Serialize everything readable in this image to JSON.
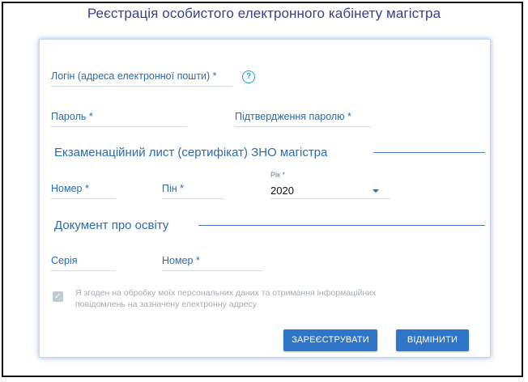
{
  "page": {
    "title": "Реєстрація особистого електронного кабінету магістра"
  },
  "form": {
    "login": {
      "label": "Логін (адреса електронної пошти) *",
      "help_icon": "?"
    },
    "password": {
      "label": "Пароль *"
    },
    "password_confirm": {
      "label": "Підтвердження паролю *"
    },
    "zno_section": {
      "title": "Екзаменаційний лист (сертифікат) ЗНО магістра",
      "number": {
        "label": "Номер *"
      },
      "pin": {
        "label": "Пін *"
      },
      "year": {
        "label": "Рік *",
        "value": "2020"
      }
    },
    "education_section": {
      "title": "Документ про освіту",
      "series": {
        "label": "Серія"
      },
      "number": {
        "label": "Номер *"
      }
    },
    "consent": {
      "checked": true,
      "text_line1": "Я згоден на обробку моїх персональних даних та отримання інформаційних",
      "text_line2": "повідомлень на зазначену електронну адресу"
    },
    "buttons": {
      "register": "ЗАРЕЄСТРУВАТИ",
      "cancel": "ВІДМІНИТИ"
    }
  },
  "colors": {
    "title": "#3a3f87",
    "label": "#2b6cb0",
    "help_icon": "#1fa3c9",
    "button": "#2f76c8",
    "card_glow": "#4678c8"
  },
  "icons": {
    "help": "question-circle-icon",
    "checkbox": "check-icon",
    "caret": "caret-down-icon"
  }
}
